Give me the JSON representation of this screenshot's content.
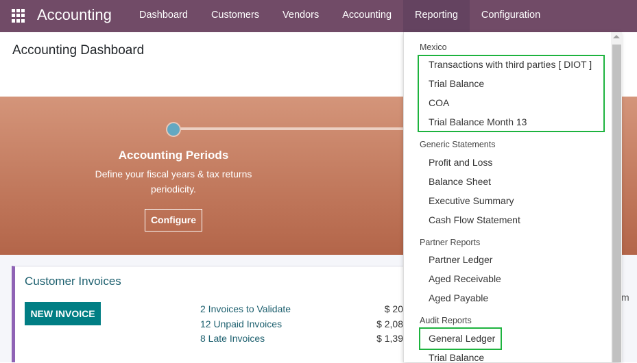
{
  "nav": {
    "brand": "Accounting",
    "items": [
      "Dashboard",
      "Customers",
      "Vendors",
      "Accounting",
      "Reporting",
      "Configuration"
    ],
    "active": "Reporting"
  },
  "page": {
    "title": "Accounting Dashboard"
  },
  "banner": {
    "title": "Accounting Periods",
    "desc1": "Define your fiscal years & tax returns",
    "desc2": "periodicity.",
    "button": "Configure"
  },
  "card": {
    "title": "Customer Invoices",
    "button": "NEW INVOICE",
    "rows": [
      {
        "label": "2 Invoices to Validate",
        "amount": "$ 20"
      },
      {
        "label": "12 Unpaid Invoices",
        "amount": "$ 2,08"
      },
      {
        "label": "8 Late Invoices",
        "amount": "$ 1,39"
      }
    ],
    "edge_text": "m"
  },
  "dropdown": {
    "sections": [
      {
        "header": "Mexico",
        "items": [
          "Transactions with third parties [ DIOT ]",
          "Trial Balance",
          "COA",
          "Trial Balance Month 13"
        ]
      },
      {
        "header": "Generic Statements",
        "items": [
          "Profit and Loss",
          "Balance Sheet",
          "Executive Summary",
          "Cash Flow Statement"
        ]
      },
      {
        "header": "Partner Reports",
        "items": [
          "Partner Ledger",
          "Aged Receivable",
          "Aged Payable"
        ]
      },
      {
        "header": "Audit Reports",
        "items": [
          "General Ledger",
          "Trial Balance"
        ]
      }
    ]
  },
  "colors": {
    "navbar": "#714b67",
    "highlight": "#1db33e",
    "primary": "#017e84"
  }
}
